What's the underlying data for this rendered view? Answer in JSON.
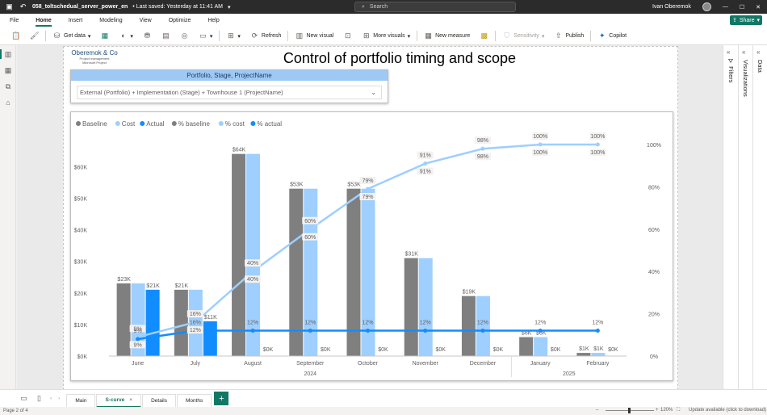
{
  "titlebar": {
    "title": "058_toltschedual_server_power_en",
    "saved": "• Last saved: Yesterday at 11:41 AM",
    "search_placeholder": "Search",
    "user_name": "Ivan Oberemok"
  },
  "menu": {
    "items": [
      "File",
      "Home",
      "Insert",
      "Modeling",
      "View",
      "Optimize",
      "Help"
    ],
    "active": "Home",
    "share_label": "Share"
  },
  "ribbon": {
    "get_data": "Get data",
    "refresh": "Refresh",
    "new_visual": "New visual",
    "more_visuals": "More visuals",
    "new_measure": "New measure",
    "sensitivity": "Sensitivity",
    "publish": "Publish",
    "copilot": "Copilot"
  },
  "report": {
    "logo_name": "Oberemok & Co",
    "logo_line2": "Project management",
    "logo_line3": "Microsoft Project",
    "title": "Control of portfolio timing and scope",
    "slicer_header": "Portfolio, Stage, ProjectName",
    "slicer_value": "External (Portfolio) + Implementation (Stage) + Townhouse 1 (ProjectName)"
  },
  "panes": {
    "filters": "Filters",
    "visualizations": "Visualizations",
    "data": "Data"
  },
  "tabs": {
    "items": [
      "Main",
      "S-curve",
      "Details",
      "Months"
    ],
    "active": "S-curve"
  },
  "status": {
    "page": "Page 2 of 4",
    "zoom": "120%",
    "update": "Update available (click to download)"
  },
  "colors": {
    "accent": "#117865",
    "baseline": "#7f7f7f",
    "cost": "#9ecfff",
    "actual": "#118dff"
  },
  "chart_data": {
    "type": "bar",
    "combo": "clustered columns with percentage lines on secondary axis",
    "legend": [
      "Baseline",
      "Cost",
      "Actual",
      "% baseline",
      "% cost",
      "% actual"
    ],
    "legend_colors": [
      "#7f7f7f",
      "#9ecfff",
      "#118dff",
      "#7f7f7f",
      "#9ecfff",
      "#118dff"
    ],
    "categories": [
      "June",
      "July",
      "August",
      "September",
      "October",
      "November",
      "December",
      "January",
      "February"
    ],
    "year_groups": [
      {
        "label": "2024",
        "from": 0,
        "to": 6
      },
      {
        "label": "2025",
        "from": 7,
        "to": 8
      }
    ],
    "y_ticks": [
      "$0K",
      "$10K",
      "$20K",
      "$30K",
      "$40K",
      "$50K",
      "$60K"
    ],
    "y2_ticks": [
      "0%",
      "20%",
      "40%",
      "60%",
      "80%",
      "100%"
    ],
    "ylim": [
      0,
      68
    ],
    "y2lim": [
      0,
      1.0
    ],
    "series": [
      {
        "name": "Baseline",
        "values": [
          23,
          21,
          64,
          53,
          53,
          31,
          19,
          6,
          1
        ],
        "labels": [
          "$23K",
          "$21K",
          "$64K",
          "$53K",
          "$53K",
          "$31K",
          "$19K",
          "$6K",
          "$1K"
        ]
      },
      {
        "name": "Cost",
        "values": [
          23,
          21,
          64,
          53,
          53,
          31,
          19,
          6,
          1
        ],
        "labels": [
          "",
          "",
          "",
          "",
          "",
          "",
          "",
          "$6K",
          "$1K"
        ]
      },
      {
        "name": "Actual",
        "values": [
          21,
          11,
          0,
          0,
          0,
          0,
          0,
          0,
          0
        ],
        "labels": [
          "$21K",
          "$11K",
          "$0K",
          "$0K",
          "$0K",
          "$0K",
          "$0K",
          "$0K",
          "$0K"
        ]
      }
    ],
    "lines": [
      {
        "name": "% baseline",
        "values": [
          0.09,
          0.16,
          0.4,
          0.6,
          0.79,
          0.91,
          0.98,
          1.0,
          1.0
        ],
        "labels": [
          "9%",
          "16%",
          "40%",
          "60%",
          "79%",
          "91%",
          "98%",
          "100%",
          "100%"
        ]
      },
      {
        "name": "% cost",
        "values": [
          0.09,
          0.16,
          0.4,
          0.6,
          0.79,
          0.91,
          0.98,
          1.0,
          1.0
        ],
        "labels": [
          "9%",
          "12%",
          "40%",
          "60%",
          "79%",
          "91%",
          "98%",
          "100%",
          "100%"
        ]
      },
      {
        "name": "% actual",
        "values": [
          0.08,
          0.12,
          0.12,
          0.12,
          0.12,
          0.12,
          0.12,
          0.12,
          0.12
        ],
        "labels": [
          "9%",
          "16%",
          "12%",
          "12%",
          "12%",
          "12%",
          "12%",
          "12%",
          "12%"
        ]
      }
    ]
  }
}
